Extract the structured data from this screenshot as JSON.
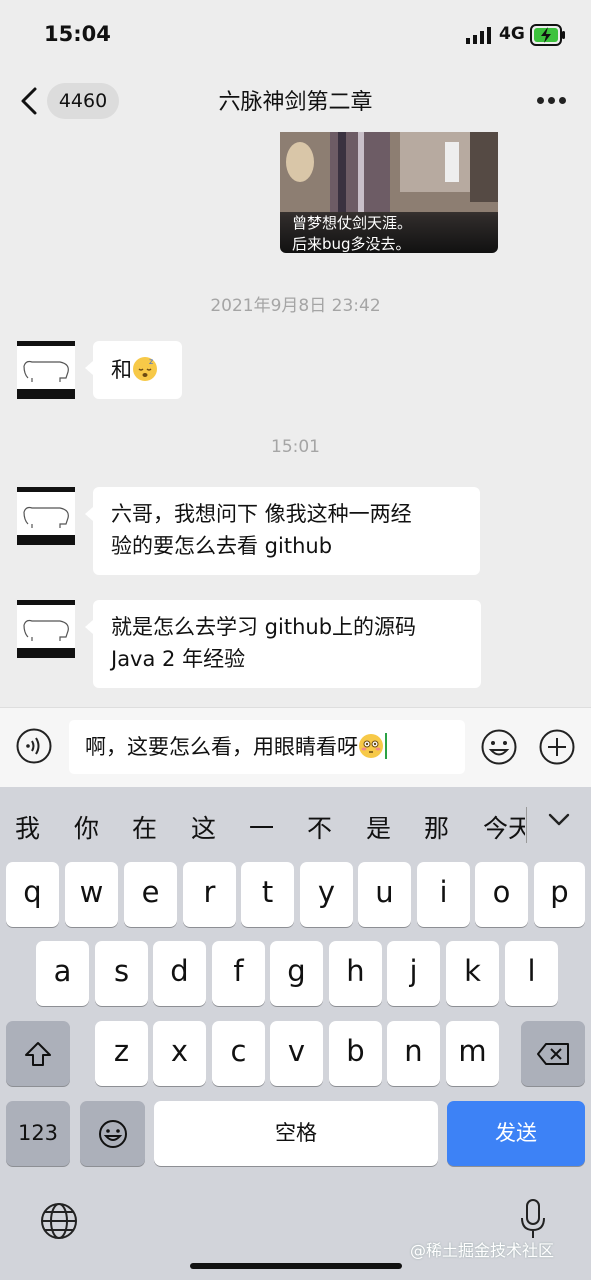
{
  "status_bar": {
    "time": "15:04",
    "network": "4G"
  },
  "nav": {
    "unread_count": "4460",
    "title": "六脉神剑第二章"
  },
  "image_message": {
    "caption_line1": "曾梦想仗剑天涯。",
    "caption_line2": "后来bug多没去。"
  },
  "timestamps": {
    "first": "2021年9月8日 23:42",
    "second": "15:01"
  },
  "messages": [
    {
      "text": "和",
      "emoji": "sleeping-face"
    },
    {
      "line1": "六哥，我想问下 像我这种一两经",
      "line2": "验的要怎么去看 github"
    },
    {
      "line1": "就是怎么去学习 github上的源码",
      "line2": "Java 2 年经验"
    }
  ],
  "input": {
    "value": "啊，这要怎么看，用眼睛看呀",
    "emoji": "flushed-face"
  },
  "candidates": [
    "我",
    "你",
    "在",
    "这",
    "一",
    "不",
    "是",
    "那",
    "今天"
  ],
  "keyboard": {
    "row1": [
      "q",
      "w",
      "e",
      "r",
      "t",
      "y",
      "u",
      "i",
      "o",
      "p"
    ],
    "row2": [
      "a",
      "s",
      "d",
      "f",
      "g",
      "h",
      "j",
      "k",
      "l"
    ],
    "row3": [
      "z",
      "x",
      "c",
      "v",
      "b",
      "n",
      "m"
    ],
    "num_label": "123",
    "space_label": "空格",
    "send_label": "发送"
  },
  "watermark": "@稀土掘金技术社区",
  "colors": {
    "send_key": "#3d82f6",
    "background": "#ededed",
    "keyboard": "#d2d4da",
    "caret": "#2ba245"
  }
}
